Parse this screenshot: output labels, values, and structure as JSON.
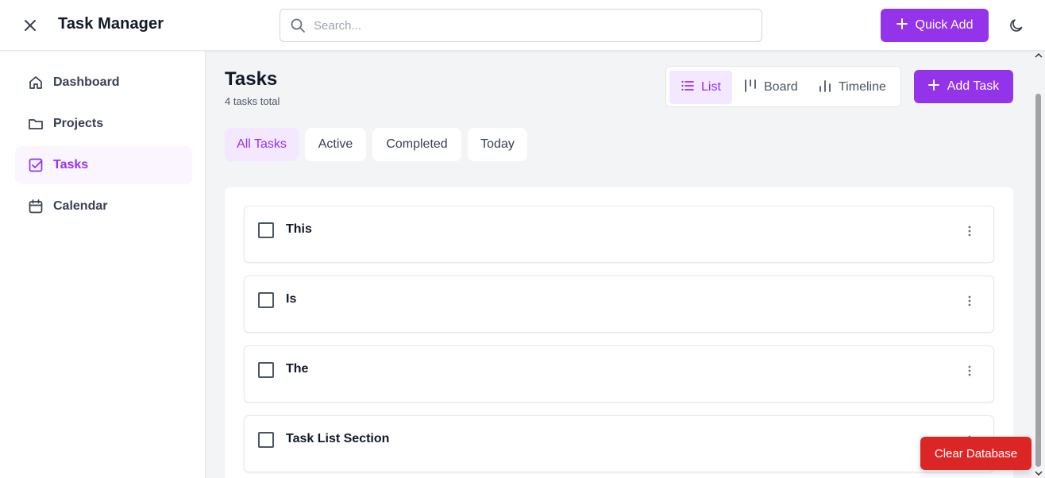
{
  "header": {
    "app_title": "Task Manager",
    "search_placeholder": "Search...",
    "quick_add_label": "Quick Add",
    "icons": {
      "close": "close-icon",
      "search": "search-icon",
      "plus": "plus-icon",
      "theme": "moon-icon"
    }
  },
  "sidebar": {
    "items": [
      {
        "label": "Dashboard",
        "icon": "home-icon",
        "active": false
      },
      {
        "label": "Projects",
        "icon": "folder-icon",
        "active": false
      },
      {
        "label": "Tasks",
        "icon": "checkbox-icon",
        "active": true
      },
      {
        "label": "Calendar",
        "icon": "calendar-icon",
        "active": false
      }
    ]
  },
  "main": {
    "title": "Tasks",
    "subtitle": "4 tasks total",
    "views": [
      {
        "label": "List",
        "icon": "list-icon",
        "active": true
      },
      {
        "label": "Board",
        "icon": "board-icon",
        "active": false
      },
      {
        "label": "Timeline",
        "icon": "timeline-icon",
        "active": false
      }
    ],
    "add_task_label": "Add Task",
    "filters": [
      {
        "label": "All Tasks",
        "active": true
      },
      {
        "label": "Active",
        "active": false
      },
      {
        "label": "Completed",
        "active": false
      },
      {
        "label": "Today",
        "active": false
      }
    ],
    "tasks": [
      {
        "title": "This",
        "completed": false
      },
      {
        "title": "Is",
        "completed": false
      },
      {
        "title": "The",
        "completed": false
      },
      {
        "title": "Task List Section",
        "completed": false
      }
    ]
  },
  "clear_database_label": "Clear Database",
  "colors": {
    "accent": "#9333ea",
    "accent_light": "#f3e8ff",
    "danger": "#dc2626",
    "background": "#f3f4f6",
    "text": "#111827"
  }
}
